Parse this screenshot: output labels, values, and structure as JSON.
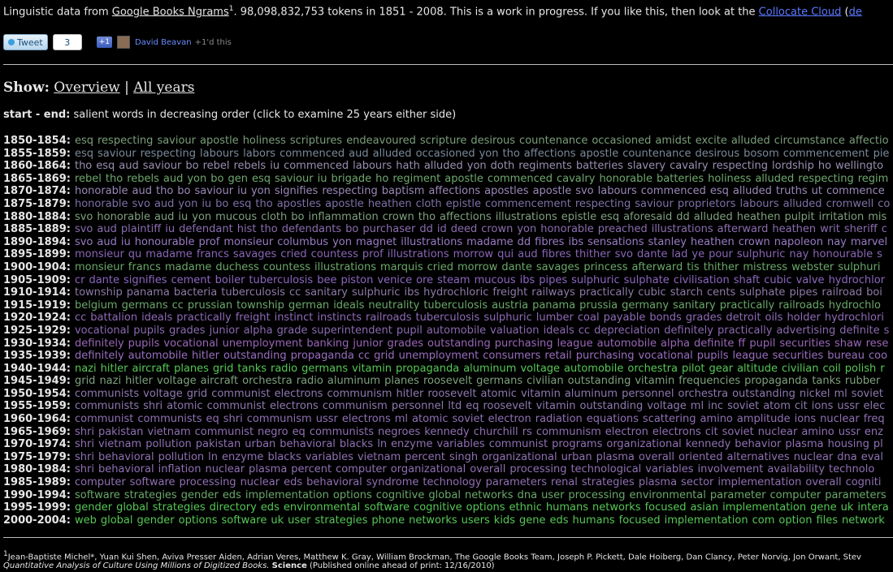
{
  "intro": {
    "prefix": "Linguistic data from ",
    "source_link": "Google Books Ngrams",
    "footnote_mark": "1",
    "stats": ". 98,098,832,753 tokens in 1851 - 2008. This is a work in progress. If you like this, then look at the ",
    "collocate_link": "Collocate Cloud",
    "trailing": " (",
    "trailing_link": "de"
  },
  "social": {
    "tweet_label": "Tweet",
    "tweet_count": "3",
    "plusone_label": "+1",
    "plusone_user": "David Beavan",
    "plusone_note": "+1'd this"
  },
  "show": {
    "label": "Show:",
    "overview_link": "Overview",
    "separator": "|",
    "all_years_link": "All years"
  },
  "legend": {
    "bold": "start - end:",
    "text": " salient words in decreasing order (click to examine 25 years either side)"
  },
  "rows": [
    {
      "range": "1850-1854:",
      "color": "#7a9e7a",
      "words": [
        "esq",
        "respecting",
        "saviour",
        "apostle",
        "holiness",
        "scriptures",
        "endeavoured",
        "scripture",
        "desirous",
        "countenance",
        "occasioned",
        "amidst",
        "excite",
        "alluded",
        "circumstance",
        "affectio"
      ]
    },
    {
      "range": "1855-1859:",
      "color": "#7a8a9a",
      "words": [
        "esq",
        "saviour",
        "respecting",
        "labours",
        "labors",
        "commenced",
        "aud",
        "alluded",
        "occasioned",
        "yon",
        "tho",
        "affections",
        "apostle",
        "countenance",
        "desirous",
        "bosom",
        "commencement",
        "pie"
      ]
    },
    {
      "range": "1860-1864:",
      "color": "#9a8fb0",
      "words": [
        "tho",
        "esq",
        "aud",
        "saviour",
        "bo",
        "rebel",
        "rebels",
        "iu",
        "commenced",
        "labours",
        "hath",
        "alluded",
        "yon",
        "doth",
        "regiments",
        "batteries",
        "slavery",
        "cavalry",
        "respecting",
        "lordship",
        "ho",
        "wellingto"
      ]
    },
    {
      "range": "1865-1869:",
      "color": "#6ea86e",
      "words": [
        "rebel",
        "tho",
        "rebels",
        "aud",
        "yon",
        "bo",
        "gen",
        "esq",
        "saviour",
        "iu",
        "brigade",
        "ho",
        "regiment",
        "apostle",
        "commenced",
        "cavalry",
        "honorable",
        "batteries",
        "holiness",
        "alluded",
        "respecting",
        "regim"
      ]
    },
    {
      "range": "1870-1874:",
      "color": "#9a88b8",
      "words": [
        "honorable",
        "aud",
        "tho",
        "bo",
        "saviour",
        "iu",
        "yon",
        "signifies",
        "respecting",
        "baptism",
        "affections",
        "apostles",
        "apostle",
        "svo",
        "labours",
        "commenced",
        "esq",
        "alluded",
        "truths",
        "ut",
        "commence"
      ]
    },
    {
      "range": "1875-1879:",
      "color": "#8070a8",
      "words": [
        "honorable",
        "svo",
        "aud",
        "yon",
        "iu",
        "bo",
        "esq",
        "tho",
        "apostles",
        "apostle",
        "heathen",
        "cloth",
        "epistle",
        "commencement",
        "respecting",
        "saviour",
        "proprietors",
        "labours",
        "alluded",
        "cromwell",
        "co"
      ]
    },
    {
      "range": "1880-1884:",
      "color": "#7ea07e",
      "words": [
        "svo",
        "honorable",
        "aud",
        "iu",
        "yon",
        "mucous",
        "cloth",
        "bo",
        "inflammation",
        "crown",
        "tho",
        "affections",
        "illustrations",
        "epistle",
        "esq",
        "aforesaid",
        "dd",
        "alluded",
        "heathen",
        "pulpit",
        "irritation",
        "mis"
      ]
    },
    {
      "range": "1885-1889:",
      "color": "#8b6db0",
      "words": [
        "svo",
        "aud",
        "plaintiff",
        "iu",
        "defendant",
        "hist",
        "tho",
        "defendants",
        "bo",
        "purchaser",
        "dd",
        "id",
        "deed",
        "crown",
        "yon",
        "honorable",
        "preached",
        "illustrations",
        "afterward",
        "heathen",
        "writ",
        "sheriff",
        "c"
      ]
    },
    {
      "range": "1890-1894:",
      "color": "#9a7cc6",
      "words": [
        "svo",
        "aud",
        "iu",
        "honourable",
        "prof",
        "monsieur",
        "columbus",
        "yon",
        "magnet",
        "illustrations",
        "madame",
        "dd",
        "fibres",
        "ibs",
        "sensations",
        "stanley",
        "heathen",
        "crown",
        "napoleon",
        "nay",
        "marvel"
      ]
    },
    {
      "range": "1895-1899:",
      "color": "#8a66b8",
      "words": [
        "monsieur",
        "qu",
        "madame",
        "francs",
        "savages",
        "cried",
        "countess",
        "prof",
        "illustrations",
        "morrow",
        "qui",
        "aud",
        "fibres",
        "thither",
        "svo",
        "dante",
        "lad",
        "ye",
        "pour",
        "sulphuric",
        "nay",
        "honourable",
        "s"
      ]
    },
    {
      "range": "1900-1904:",
      "color": "#6aa86a",
      "words": [
        "monsieur",
        "francs",
        "madame",
        "duchess",
        "countess",
        "illustrations",
        "marquis",
        "cried",
        "morrow",
        "dante",
        "savages",
        "princess",
        "afterward",
        "tis",
        "thither",
        "mistress",
        "webster",
        "sulphuri"
      ]
    },
    {
      "range": "1905-1909:",
      "color": "#8c66c0",
      "words": [
        "cr",
        "dante",
        "signifies",
        "cement",
        "boiler",
        "tuberculosis",
        "bee",
        "piston",
        "venice",
        "ore",
        "steam",
        "mucous",
        "ibs",
        "pipes",
        "sulphuric",
        "sulphate",
        "civilisation",
        "shaft",
        "cubic",
        "valve",
        "hydrochlor"
      ]
    },
    {
      "range": "1910-1914:",
      "color": "#8e7aa8",
      "words": [
        "township",
        "panama",
        "bacteria",
        "tuberculosis",
        "cc",
        "sanitary",
        "sulphuric",
        "ibs",
        "hydrochloric",
        "freight",
        "railways",
        "practically",
        "cubic",
        "starch",
        "cents",
        "sulphate",
        "pipes",
        "railroad",
        "boi"
      ]
    },
    {
      "range": "1915-1919:",
      "color": "#6aa86a",
      "words": [
        "belgium",
        "germans",
        "cc",
        "prussian",
        "township",
        "german",
        "ideals",
        "neutrality",
        "tuberculosis",
        "austria",
        "panama",
        "prussia",
        "germany",
        "sanitary",
        "practically",
        "railroads",
        "hydrochlo"
      ]
    },
    {
      "range": "1920-1924:",
      "color": "#8e6ab8",
      "words": [
        "cc",
        "battalion",
        "ideals",
        "practically",
        "freight",
        "instinct",
        "instincts",
        "railroads",
        "tuberculosis",
        "sulphuric",
        "lumber",
        "coal",
        "payable",
        "bonds",
        "grades",
        "detroit",
        "oils",
        "holder",
        "hydrochlori"
      ]
    },
    {
      "range": "1925-1929:",
      "color": "#8a6ab0",
      "words": [
        "vocational",
        "pupils",
        "grades",
        "junior",
        "alpha",
        "grade",
        "superintendent",
        "pupil",
        "automobile",
        "valuation",
        "ideals",
        "cc",
        "depreciation",
        "definitely",
        "practically",
        "advertising",
        "definite",
        "s"
      ]
    },
    {
      "range": "1930-1934:",
      "color": "#9a66b8",
      "words": [
        "definitely",
        "pupils",
        "vocational",
        "unemployment",
        "banking",
        "junior",
        "grades",
        "outstanding",
        "purchasing",
        "league",
        "automobile",
        "alpha",
        "definite",
        "ff",
        "pupil",
        "securities",
        "shaw",
        "rese"
      ]
    },
    {
      "range": "1935-1939:",
      "color": "#9a6ec0",
      "words": [
        "definitely",
        "automobile",
        "hitler",
        "outstanding",
        "propaganda",
        "cc",
        "grid",
        "unemployment",
        "consumers",
        "retail",
        "purchasing",
        "vocational",
        "pupils",
        "league",
        "securities",
        "bureau",
        "coo"
      ]
    },
    {
      "range": "1940-1944:",
      "color": "#55c855",
      "words": [
        "nazi",
        "hitler",
        "aircraft",
        "planes",
        "grid",
        "tanks",
        "radio",
        "germans",
        "vitamin",
        "propaganda",
        "aluminum",
        "voltage",
        "automobile",
        "orchestra",
        "pilot",
        "gear",
        "altitude",
        "civilian",
        "coil",
        "polish",
        "r"
      ]
    },
    {
      "range": "1945-1949:",
      "color": "#7ea07e",
      "words": [
        "grid",
        "nazi",
        "hitler",
        "voltage",
        "aircraft",
        "orchestra",
        "radio",
        "aluminum",
        "planes",
        "roosevelt",
        "germans",
        "civilian",
        "outstanding",
        "vitamin",
        "frequencies",
        "propaganda",
        "tanks",
        "rubber"
      ]
    },
    {
      "range": "1950-1954:",
      "color": "#8e78b0",
      "words": [
        "communists",
        "voltage",
        "grid",
        "communist",
        "electrons",
        "communism",
        "hitler",
        "roosevelt",
        "atomic",
        "vitamin",
        "aluminum",
        "personnel",
        "orchestra",
        "outstanding",
        "nickel",
        "ml",
        "soviet"
      ]
    },
    {
      "range": "1955-1959:",
      "color": "#8e78b0",
      "words": [
        "communists",
        "shri",
        "atomic",
        "communist",
        "electrons",
        "communism",
        "personnel",
        "ltd",
        "eq",
        "roosevelt",
        "vitamin",
        "outstanding",
        "voltage",
        "ml",
        "inc",
        "soviet",
        "atom",
        "cit",
        "ions",
        "ussr",
        "elec"
      ]
    },
    {
      "range": "1960-1964:",
      "color": "#9070b4",
      "words": [
        "communist",
        "communists",
        "eq",
        "shri",
        "communism",
        "ussr",
        "electrons",
        "ml",
        "atomic",
        "soviet",
        "electron",
        "radiation",
        "equations",
        "scattering",
        "amino",
        "amplitude",
        "ions",
        "nuclear",
        "freq"
      ]
    },
    {
      "range": "1965-1969:",
      "color": "#9070b4",
      "words": [
        "shri",
        "pakistan",
        "vietnam",
        "communist",
        "negro",
        "eq",
        "communists",
        "negroes",
        "kennedy",
        "churchill",
        "rs",
        "communism",
        "electron",
        "electrons",
        "cit",
        "soviet",
        "nuclear",
        "amino",
        "ussr",
        "enz"
      ]
    },
    {
      "range": "1970-1974:",
      "color": "#9070b4",
      "words": [
        "shri",
        "vietnam",
        "pollution",
        "pakistan",
        "urban",
        "behavioral",
        "blacks",
        "ln",
        "enzyme",
        "variables",
        "communist",
        "programs",
        "organizational",
        "kennedy",
        "behavior",
        "plasma",
        "housing",
        "pl"
      ]
    },
    {
      "range": "1975-1979:",
      "color": "#9070b4",
      "words": [
        "shri",
        "behavioral",
        "pollution",
        "ln",
        "enzyme",
        "blacks",
        "variables",
        "vietnam",
        "percent",
        "singh",
        "organizational",
        "urban",
        "plasma",
        "overall",
        "oriented",
        "alternatives",
        "nuclear",
        "dna",
        "eval"
      ]
    },
    {
      "range": "1980-1984:",
      "color": "#9070b4",
      "words": [
        "shri",
        "behavioral",
        "inflation",
        "nuclear",
        "plasma",
        "percent",
        "computer",
        "organizational",
        "overall",
        "processing",
        "technological",
        "variables",
        "involvement",
        "availability",
        "technolo"
      ]
    },
    {
      "range": "1985-1989:",
      "color": "#9070b4",
      "words": [
        "computer",
        "software",
        "processing",
        "nuclear",
        "eds",
        "behavioral",
        "syndrome",
        "technology",
        "parameters",
        "renal",
        "strategies",
        "plasma",
        "sector",
        "implementation",
        "overall",
        "cogniti"
      ]
    },
    {
      "range": "1990-1994:",
      "color": "#6aa86a",
      "words": [
        "software",
        "strategies",
        "gender",
        "eds",
        "implementation",
        "options",
        "cognitive",
        "global",
        "networks",
        "dna",
        "user",
        "processing",
        "environmental",
        "parameter",
        "computer",
        "parameters"
      ]
    },
    {
      "range": "1995-1999:",
      "color": "#55c855",
      "words": [
        "gender",
        "global",
        "strategies",
        "directory",
        "eds",
        "environmental",
        "software",
        "cognitive",
        "options",
        "ethnic",
        "humans",
        "networks",
        "focused",
        "asian",
        "implementation",
        "gene",
        "uk",
        "intera"
      ]
    },
    {
      "range": "2000-2004:",
      "color": "#55c855",
      "words": [
        "web",
        "global",
        "gender",
        "options",
        "software",
        "uk",
        "user",
        "strategies",
        "phone",
        "networks",
        "users",
        "kids",
        "gene",
        "eds",
        "humans",
        "focused",
        "implementation",
        "com",
        "option",
        "files",
        "network"
      ]
    }
  ],
  "footnote": {
    "mark": "1",
    "authors": "Jean-Baptiste Michel*, Yuan Kui Shen, Aviva Presser Aiden, Adrian Veres, Matthew K. Gray, William Brockman, The Google Books Team, Joseph P. Pickett, Dale Hoiberg, Dan Clancy, Peter Norvig, Jon Orwant, Stev",
    "title_italic": "Quantitative Analysis of Culture Using Millions of Digitized Books.",
    "journal": "Science",
    "published": "(Published online ahead of print: 12/16/2010)"
  }
}
